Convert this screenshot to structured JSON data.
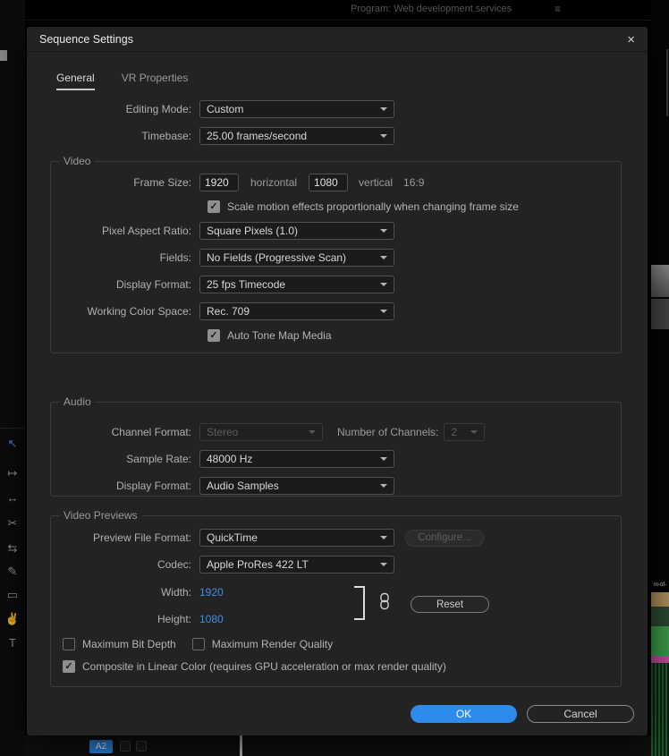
{
  "icons": {
    "close": "×",
    "menu": "≡"
  },
  "chrome": {
    "program_bar": {
      "title": "Program: Web development services"
    },
    "tools": [
      {
        "name": "selection-tool",
        "glyph": "↖"
      },
      {
        "name": "track-select-tool",
        "glyph": "↦"
      },
      {
        "name": "ripple-edit-tool",
        "glyph": "↔"
      },
      {
        "name": "razor-tool",
        "glyph": "✂"
      },
      {
        "name": "slip-tool",
        "glyph": "⇆"
      },
      {
        "name": "pen-tool",
        "glyph": "✎"
      },
      {
        "name": "rectangle-tool",
        "glyph": "▭"
      },
      {
        "name": "hand-tool",
        "glyph": "✌"
      },
      {
        "name": "type-tool",
        "glyph": "T"
      }
    ],
    "clip_label": "m-of-",
    "bottom": {
      "track_badge": "A2"
    }
  },
  "dialog": {
    "title": "Sequence Settings",
    "tabs": [
      {
        "label": "General"
      },
      {
        "label": "VR Properties"
      }
    ],
    "editing_mode": {
      "label": "Editing Mode:",
      "value": "Custom"
    },
    "timebase": {
      "label": "Timebase:",
      "value": "25.00  frames/second"
    },
    "video": {
      "title": "Video",
      "frame_size": {
        "label": "Frame Size:",
        "horizontal_value": "1920",
        "horizontal_label": "horizontal",
        "vertical_value": "1080",
        "vertical_label": "vertical",
        "aspect_ratio": "16:9"
      },
      "scale_motion": {
        "label": "Scale motion effects proportionally when changing frame size",
        "checked": true
      },
      "pixel_aspect_ratio": {
        "label": "Pixel Aspect Ratio:",
        "value": "Square Pixels (1.0)"
      },
      "fields": {
        "label": "Fields:",
        "value": "No Fields (Progressive Scan)"
      },
      "display_format": {
        "label": "Display Format:",
        "value": "25 fps Timecode"
      },
      "working_color_space": {
        "label": "Working Color Space:",
        "value": "Rec. 709"
      },
      "auto_tone_map": {
        "label": "Auto Tone Map Media",
        "checked": true
      }
    },
    "audio": {
      "title": "Audio",
      "channel_format": {
        "label": "Channel Format:",
        "value": "Stereo",
        "disabled": true
      },
      "number_of_channels": {
        "label": "Number of Channels:",
        "value": "2",
        "disabled": true
      },
      "sample_rate": {
        "label": "Sample Rate:",
        "value": "48000 Hz"
      },
      "display_format": {
        "label": "Display Format:",
        "value": "Audio Samples"
      }
    },
    "video_previews": {
      "title": "Video Previews",
      "preview_file_format": {
        "label": "Preview File Format:",
        "value": "QuickTime"
      },
      "configure_button": "Configure...",
      "codec": {
        "label": "Codec:",
        "value": "Apple ProRes 422 LT"
      },
      "width": {
        "label": "Width:",
        "value": "1920"
      },
      "height": {
        "label": "Height:",
        "value": "1080"
      },
      "reset_button": "Reset",
      "max_bit_depth": {
        "label": "Maximum Bit Depth",
        "checked": false
      },
      "max_render_quality": {
        "label": "Maximum Render Quality",
        "checked": false
      },
      "composite_linear": {
        "label": "Composite in Linear Color (requires GPU acceleration or max render quality)",
        "checked": true
      }
    },
    "ok_button": "OK",
    "cancel_button": "Cancel"
  },
  "colors": {
    "accent_blue": "#2d8ceb",
    "value_blue": "#3f8fe8",
    "dialog_bg": "#232323"
  }
}
